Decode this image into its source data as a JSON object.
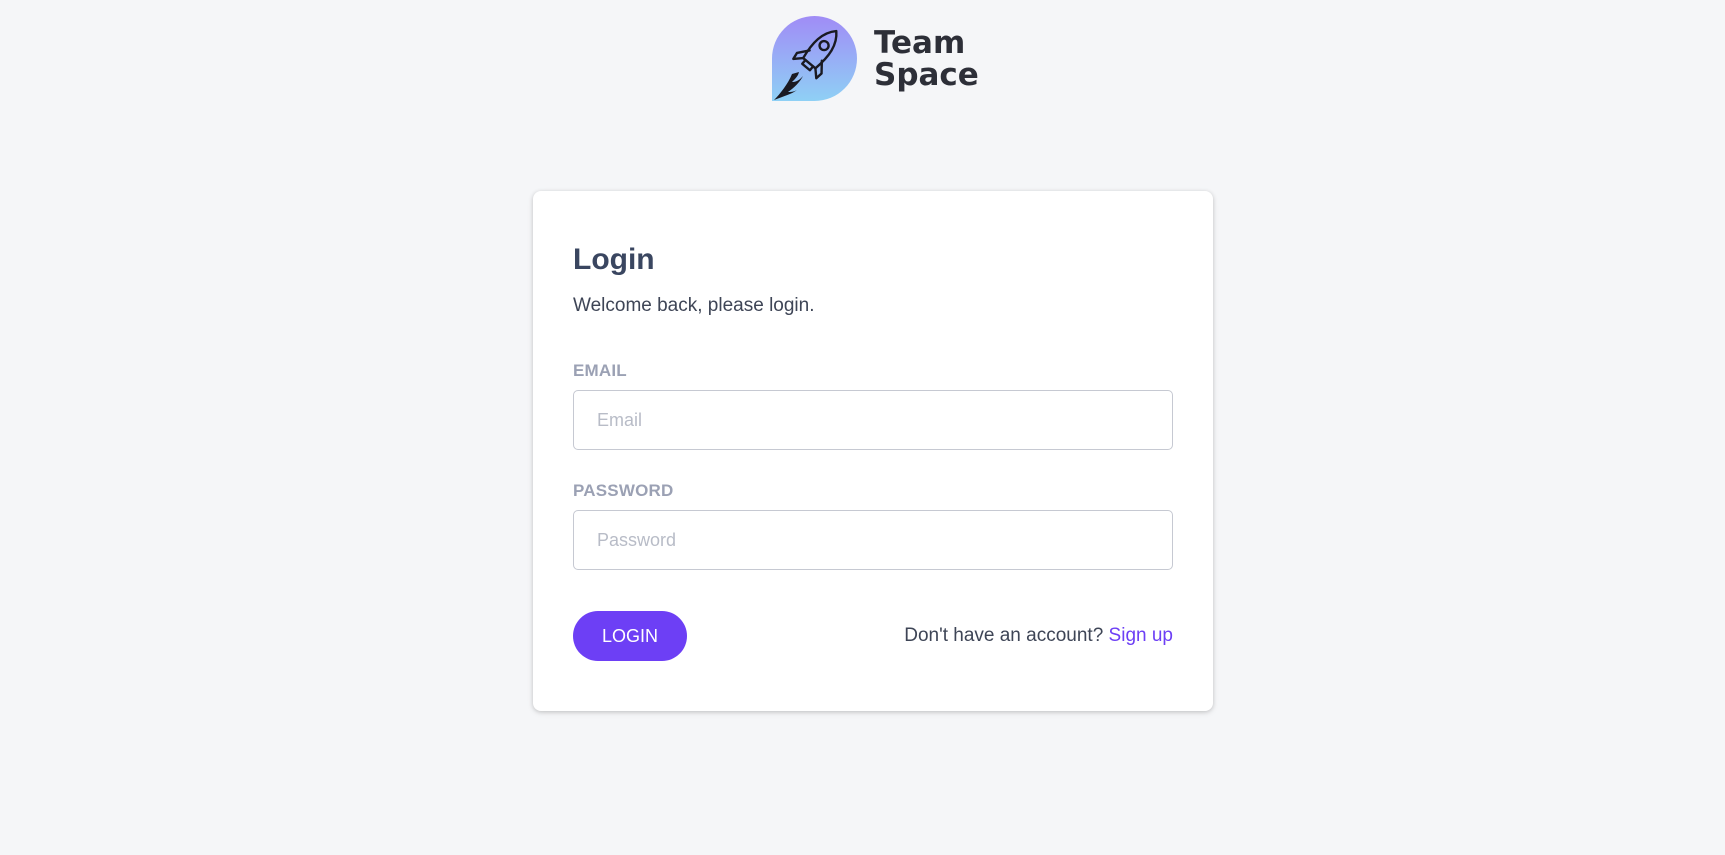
{
  "brand": {
    "logo_icon": "rocket-icon",
    "name_line1": "Team",
    "name_line2": "Space",
    "logo_gradient": [
      "#a08cf6",
      "#8fd0f5"
    ]
  },
  "login_card": {
    "title": "Login",
    "subtitle": "Welcome back, please login.",
    "email": {
      "label": "EMAIL",
      "placeholder": "Email",
      "value": ""
    },
    "password": {
      "label": "PASSWORD",
      "placeholder": "Password",
      "value": ""
    },
    "login_button_label": "LOGIN",
    "signup_prompt": "Don't have an account?",
    "signup_link_label": "Sign up"
  },
  "colors": {
    "accent": "#6d3ff5",
    "background": "#f5f6f8",
    "title": "#3a4660",
    "label": "#9ba1b4"
  }
}
